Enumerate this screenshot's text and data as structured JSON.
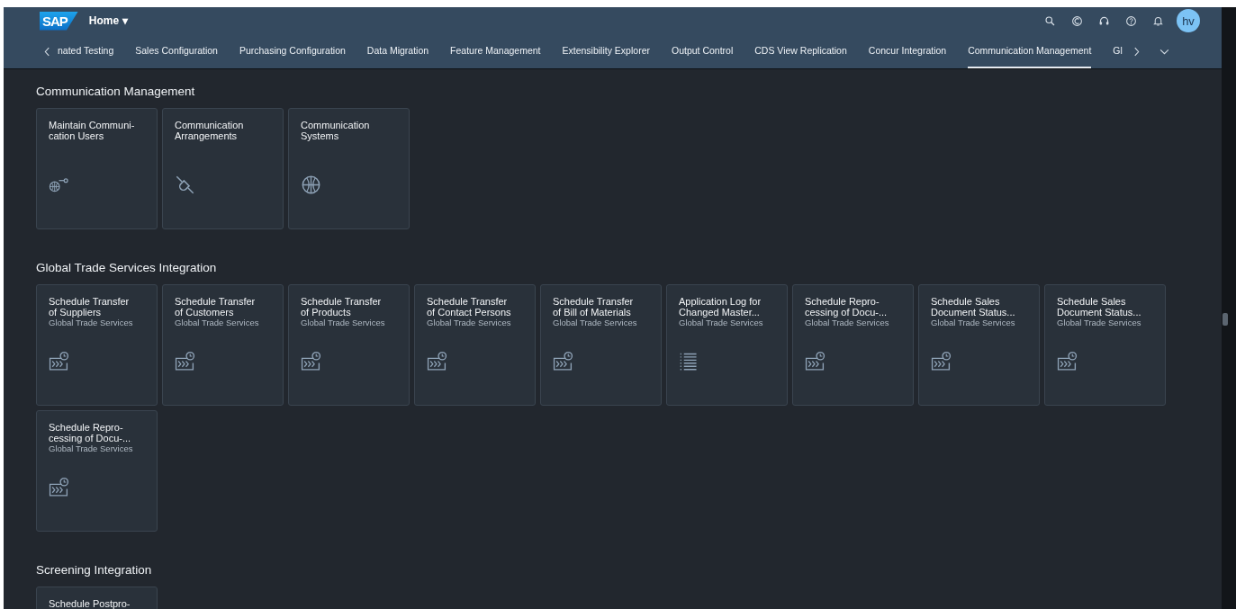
{
  "shell": {
    "logo": "SAP",
    "title": "Home",
    "title_caret": "▾",
    "avatar": "hv"
  },
  "tabs": [
    {
      "label": "nated Testing",
      "selected": false
    },
    {
      "label": "Sales Configuration",
      "selected": false
    },
    {
      "label": "Purchasing Configuration",
      "selected": false
    },
    {
      "label": "Data Migration",
      "selected": false
    },
    {
      "label": "Feature Management",
      "selected": false
    },
    {
      "label": "Extensibility Explorer",
      "selected": false
    },
    {
      "label": "Output Control",
      "selected": false
    },
    {
      "label": "CDS View Replication",
      "selected": false
    },
    {
      "label": "Concur Integration",
      "selected": false
    },
    {
      "label": "Communication Management",
      "selected": true
    },
    {
      "label": "Gl",
      "selected": false
    }
  ],
  "sections": [
    {
      "title": "Communication Management",
      "tiles": [
        {
          "title": "Maintain Communi-\ncation Users",
          "kind": "users"
        },
        {
          "title": "Communication\nArrangements",
          "kind": "arrangement"
        },
        {
          "title": "Communication\nSystems",
          "kind": "system"
        }
      ]
    },
    {
      "title": "Global Trade Services Integration",
      "tiles": [
        {
          "title": "Schedule Transfer\nof Suppliers",
          "subtitle": "Global Trade Services",
          "kind": "job"
        },
        {
          "title": "Schedule Transfer\nof Customers",
          "subtitle": "Global Trade Services",
          "kind": "job"
        },
        {
          "title": "Schedule Transfer\nof Products",
          "subtitle": "Global Trade Services",
          "kind": "job"
        },
        {
          "title": "Schedule Transfer\nof Contact Persons",
          "subtitle": "Global Trade Services",
          "kind": "job"
        },
        {
          "title": "Schedule Transfer\nof Bill of Materials",
          "subtitle": "Global Trade Services",
          "kind": "job"
        },
        {
          "title": "Application Log for\nChanged Master...",
          "subtitle": "Global Trade Services",
          "kind": "log"
        },
        {
          "title": "Schedule Repro-\ncessing of Docu-...",
          "subtitle": "Global Trade Services",
          "kind": "job"
        },
        {
          "title": "Schedule Sales\nDocument Status...",
          "subtitle": "Global Trade Services",
          "kind": "job"
        },
        {
          "title": "Schedule Sales\nDocument Status...",
          "subtitle": "Global Trade Services",
          "kind": "job"
        },
        {
          "title": "Schedule Repro-\ncessing of Docu-...",
          "subtitle": "Global Trade Services",
          "kind": "job"
        }
      ]
    },
    {
      "title": "Screening Integration",
      "tiles": [
        {
          "title": "Schedule Postpro-"
        }
      ]
    }
  ]
}
